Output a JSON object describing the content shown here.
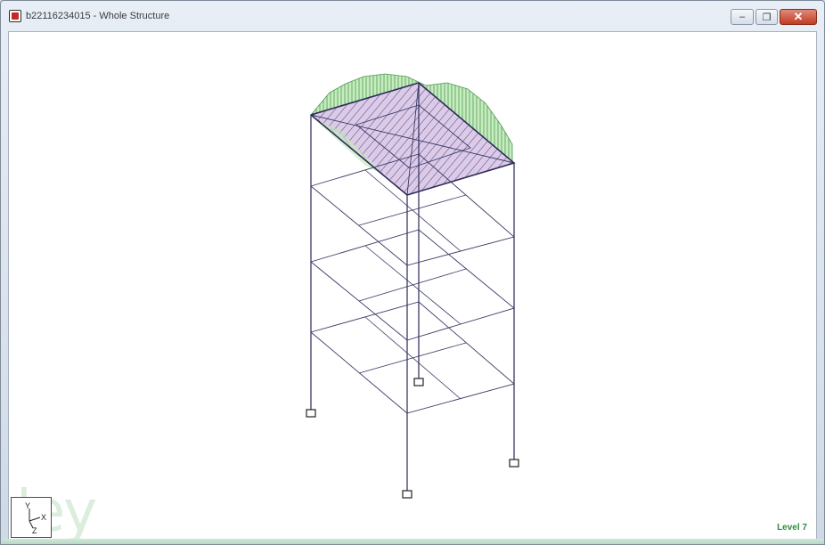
{
  "window": {
    "title": "b22116234015 - Whole Structure",
    "controls": {
      "minimize_icon": "minimize-icon",
      "maximize_icon": "maximize-icon",
      "close_icon": "close-icon"
    }
  },
  "viewport": {
    "axes": {
      "x": "X",
      "y": "Y",
      "z": "Z"
    },
    "status": "Level 7",
    "watermark": "ley"
  },
  "colors": {
    "frame": "#3a3a66",
    "roof_fill": "#d9c8e6",
    "roof_hatch": "#5b4b7a",
    "load_fill": "#b9e6b3",
    "status": "#2e8b3d"
  }
}
